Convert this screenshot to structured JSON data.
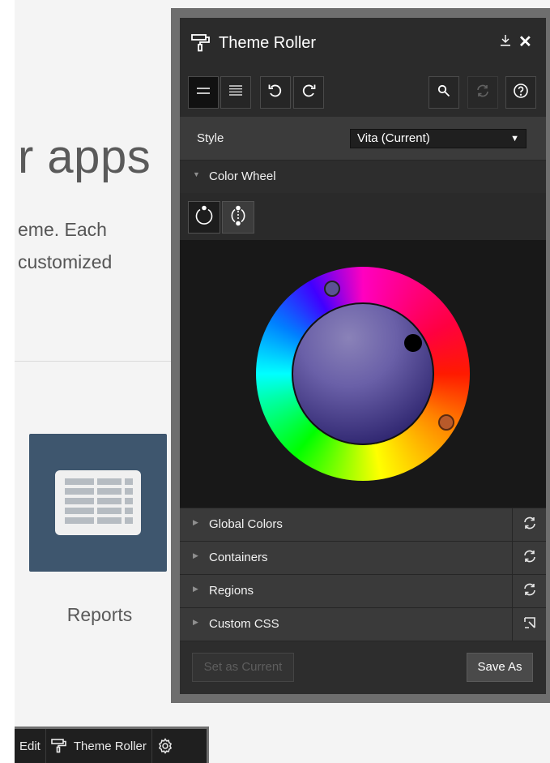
{
  "background": {
    "hero_title": "r apps",
    "hero_line1": "eme. Each",
    "hero_line2": "customized",
    "tile_label": "Reports"
  },
  "devbar": {
    "edit_label": "Edit",
    "theme_roller_label": "Theme Roller",
    "settings_icon": "gear-icon"
  },
  "dialog": {
    "title": "Theme Roller",
    "title_icon": "paint-roller-icon",
    "pin_icon": "pin-icon",
    "close_glyph": "✕",
    "style_label": "Style",
    "style_value": "Vita (Current)",
    "sections": {
      "color_wheel": "Color Wheel",
      "global_colors": "Global Colors",
      "containers": "Containers",
      "regions": "Regions",
      "custom_css": "Custom CSS"
    },
    "buttons": {
      "set_current": "Set as Current",
      "save_as": "Save As"
    }
  },
  "colors": {
    "accent_handle_purple": "#5b5294",
    "accent_handle_black": "#000000",
    "accent_handle_orange": "#b85a2a",
    "tile_bg": "#3e566e"
  }
}
